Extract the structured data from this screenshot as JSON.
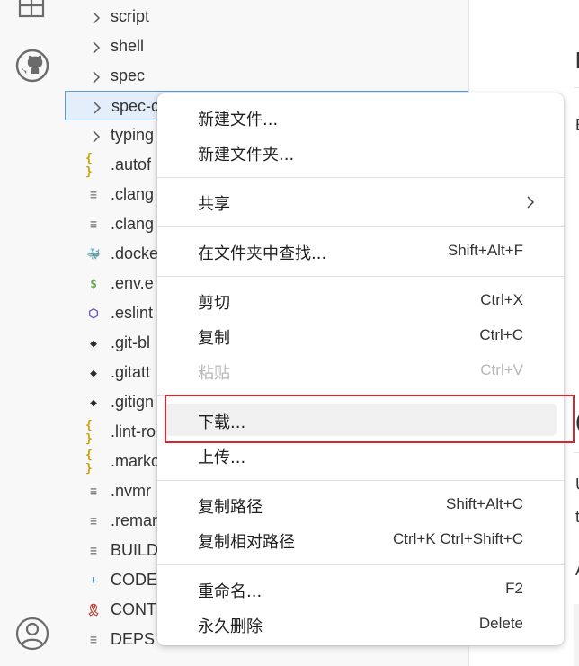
{
  "explorer": {
    "items": [
      {
        "label": "script",
        "kind": "folder",
        "icon": "chevron-right-icon"
      },
      {
        "label": "shell",
        "kind": "folder",
        "icon": "chevron-right-icon"
      },
      {
        "label": "spec",
        "kind": "folder",
        "icon": "chevron-right-icon"
      },
      {
        "label": "spec-c",
        "kind": "folder",
        "icon": "chevron-right-icon"
      },
      {
        "label": "typing",
        "kind": "folder",
        "icon": "chevron-right-icon"
      },
      {
        "label": ".autof",
        "kind": "file",
        "icon": "json-braces-icon",
        "glyph": "{ }",
        "color": "#c9a100"
      },
      {
        "label": ".clang",
        "kind": "file",
        "icon": "text-lines-icon",
        "glyph": "≡",
        "color": "#888888"
      },
      {
        "label": ".clang",
        "kind": "file",
        "icon": "text-lines-icon",
        "glyph": "≡",
        "color": "#888888"
      },
      {
        "label": ".docke",
        "kind": "file",
        "icon": "docker-whale-icon",
        "glyph": "🐳",
        "color": "#4a7fa8"
      },
      {
        "label": ".env.e",
        "kind": "file",
        "icon": "dollar-icon",
        "glyph": "$",
        "color": "#6aa84f"
      },
      {
        "label": ".eslint",
        "kind": "file",
        "icon": "eslint-hex-icon",
        "glyph": "⬡",
        "color": "#6b4fbb"
      },
      {
        "label": ".git-bl",
        "kind": "file",
        "icon": "git-diamond-icon",
        "glyph": "◆",
        "color": "#2b2b2b"
      },
      {
        "label": ".gitatt",
        "kind": "file",
        "icon": "git-diamond-icon",
        "glyph": "◆",
        "color": "#2b2b2b"
      },
      {
        "label": ".gitign",
        "kind": "file",
        "icon": "git-diamond-icon",
        "glyph": "◆",
        "color": "#2b2b2b"
      },
      {
        "label": ".lint-ro",
        "kind": "file",
        "icon": "json-braces-icon",
        "glyph": "{ }",
        "color": "#c9a100"
      },
      {
        "label": ".marko",
        "kind": "file",
        "icon": "json-braces-icon",
        "glyph": "{ }",
        "color": "#c9a100"
      },
      {
        "label": ".nvmr",
        "kind": "file",
        "icon": "text-lines-icon",
        "glyph": "≡",
        "color": "#888888"
      },
      {
        "label": ".remar",
        "kind": "file",
        "icon": "text-lines-icon",
        "glyph": "≡",
        "color": "#888888"
      },
      {
        "label": "BUILD",
        "kind": "file",
        "icon": "text-lines-icon",
        "glyph": "≡",
        "color": "#888888"
      },
      {
        "label": "CODE",
        "kind": "file",
        "icon": "arrow-down-icon",
        "glyph": "⬇",
        "color": "#3a7bbf"
      },
      {
        "label": "CONT",
        "kind": "file",
        "icon": "ribbon-icon",
        "glyph": "🎗",
        "color": "#c0392b"
      },
      {
        "label": "DEPS",
        "kind": "file",
        "icon": "text-lines-icon",
        "glyph": "≡",
        "color": "#888888"
      }
    ]
  },
  "menu": {
    "groups": [
      [
        {
          "label": "新建文件...",
          "shortcut": "",
          "disabled": false
        },
        {
          "label": "新建文件夹...",
          "shortcut": "",
          "disabled": false
        }
      ],
      [
        {
          "label": "共享",
          "shortcut": "",
          "disabled": false,
          "submenu": true
        }
      ],
      [
        {
          "label": "在文件夹中查找...",
          "shortcut": "Shift+Alt+F",
          "disabled": false
        }
      ],
      [
        {
          "label": "剪切",
          "shortcut": "Ctrl+X",
          "disabled": false
        },
        {
          "label": "复制",
          "shortcut": "Ctrl+C",
          "disabled": false
        },
        {
          "label": "粘贴",
          "shortcut": "Ctrl+V",
          "disabled": true
        }
      ],
      [
        {
          "label": "下载...",
          "shortcut": "",
          "disabled": false,
          "hover": true
        },
        {
          "label": "上传...",
          "shortcut": "",
          "disabled": false
        }
      ],
      [
        {
          "label": "复制路径",
          "shortcut": "Shift+Alt+C",
          "disabled": false
        },
        {
          "label": "复制相对路径",
          "shortcut": "Ctrl+K Ctrl+Shift+C",
          "disabled": false
        }
      ],
      [
        {
          "label": "重命名...",
          "shortcut": "F2",
          "disabled": false
        },
        {
          "label": "永久删除",
          "shortcut": "Delete",
          "disabled": false
        }
      ]
    ]
  },
  "editor": {
    "fragments": [
      "I",
      "E",
      "C",
      "U",
      "t",
      "A"
    ]
  },
  "colors": {
    "selection_border": "#5b9bd5",
    "highlight_box": "#d7262e",
    "hover_bg": "#f0f0f0"
  }
}
